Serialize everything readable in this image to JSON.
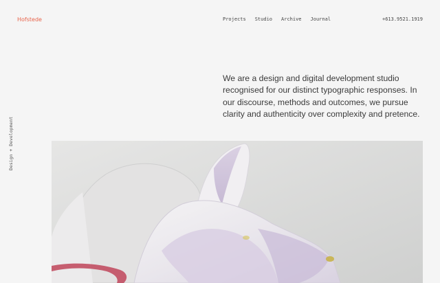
{
  "header": {
    "logo": "Hofstede",
    "nav": [
      {
        "label": "Projects"
      },
      {
        "label": "Studio"
      },
      {
        "label": "Archive"
      },
      {
        "label": "Journal"
      }
    ],
    "phone": "+613.9521.1919"
  },
  "intro": {
    "text": "We are a design and digital development studio recognised for our distinct typographic responses. In our discourse, methods and outcomes, we pursue clarity and authenticity over complexity and pretence."
  },
  "side_label": "Design + Development",
  "hero": {
    "image_subject": "white fabric sculpture with lilac folds",
    "colors": {
      "background": "#d9dad9",
      "fabric": "#efedf0",
      "lilac": "#cfc2db",
      "accent_red": "#c0455a",
      "accent_yellow": "#c8b24a"
    }
  }
}
